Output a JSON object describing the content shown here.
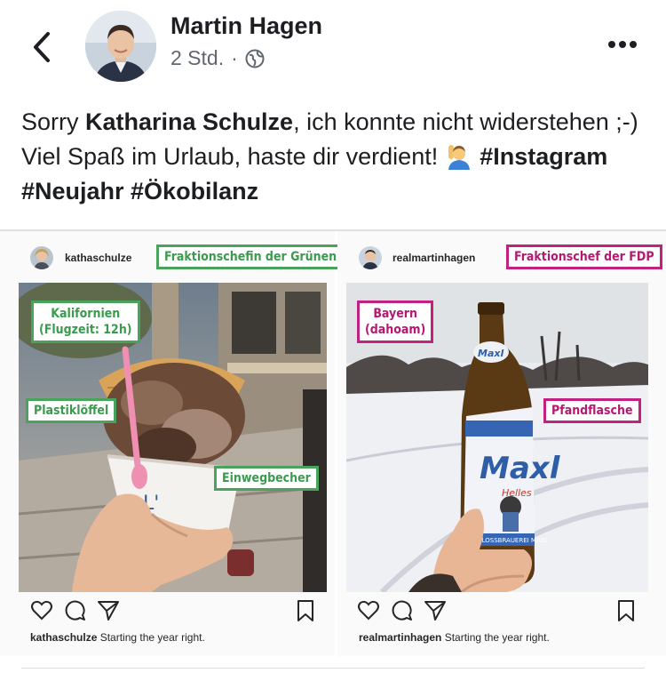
{
  "post": {
    "author": "Martin Hagen",
    "time": "2 Std.",
    "separator": "·",
    "text_part1": "Sorry ",
    "mention": "Katharina Schulze",
    "text_part2": ", ich konnte nicht widerstehen ;-) Viel Spaß im Urlaub, haste dir verdient! ",
    "hashtags": "#Instagram #Neujahr #Ökobilanz"
  },
  "left_post": {
    "username": "kathaschulze",
    "tag": "Fraktionschefin der Grünen",
    "labels": {
      "location_line1": "Kalifornien",
      "location_line2": "(Flugzeit: 12h)",
      "spoon": "Plastiklöffel",
      "cup": "Einwegbecher"
    },
    "cup_text": "L'",
    "caption": "Starting the year right."
  },
  "right_post": {
    "username": "realmartinhagen",
    "tag": "Fraktionschef der FDP",
    "labels": {
      "location_line1": "Bayern",
      "location_line2": "(dahoam)",
      "bottle": "Pfandflasche"
    },
    "bottle_brand": "Maxl",
    "bottle_sub": "Helles",
    "bottle_band": "SCHLOSSBRAUEREI MAXL",
    "caption": "Starting the year right."
  },
  "colors": {
    "green": "#4aa35a",
    "pink": "#c2227f",
    "text": "#1c1e21",
    "meta": "#606770"
  }
}
